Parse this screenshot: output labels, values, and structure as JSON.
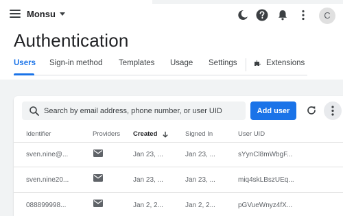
{
  "header": {
    "project_name": "Monsu",
    "avatar_letter": "C",
    "icons": [
      "menu-icon",
      "dark-mode-icon",
      "help-icon",
      "notifications-icon",
      "more-vert-icon"
    ]
  },
  "page": {
    "title": "Authentication",
    "tabs": [
      {
        "label": "Users"
      },
      {
        "label": "Sign-in method"
      },
      {
        "label": "Templates"
      },
      {
        "label": "Usage"
      },
      {
        "label": "Settings"
      },
      {
        "label": "Extensions"
      }
    ],
    "active_tab": "Users"
  },
  "users_table": {
    "search_placeholder": "Search by email address, phone number, or user UID",
    "add_user_label": "Add user",
    "columns": [
      "Identifier",
      "Providers",
      "Created",
      "Signed In",
      "User UID"
    ],
    "sorted_column": "Created",
    "rows": [
      {
        "identifier": "sven.nine@...",
        "provider": "email-icon",
        "created": "Jan 23, ...",
        "signed_in": "Jan 23, ...",
        "uid": "sYynCl8mWbgF..."
      },
      {
        "identifier": "sven.nine20...",
        "provider": "email-icon",
        "created": "Jan 23, ...",
        "signed_in": "Jan 23, ...",
        "uid": "miq4skLBszUEq..."
      },
      {
        "identifier": "088899998...",
        "provider": "email-icon",
        "created": "Jan 2, 2...",
        "signed_in": "Jan 2, 2...",
        "uid": "pGVueWnyz4fX..."
      }
    ]
  },
  "colors": {
    "accent": "#1a73e8",
    "background": "#f1f3f4",
    "surface": "#ffffff"
  }
}
